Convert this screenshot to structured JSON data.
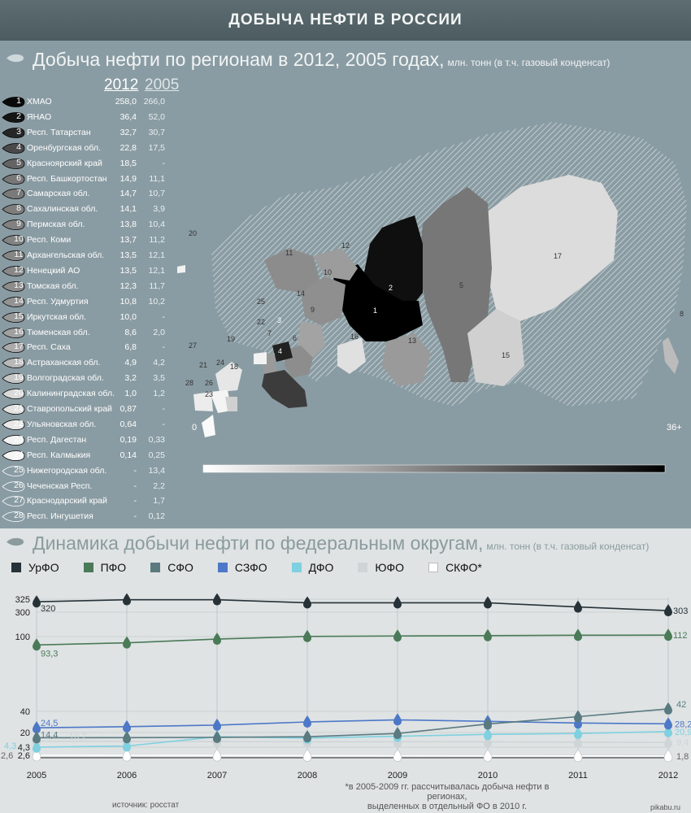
{
  "banner_title": "ДОБЫЧА НЕФТИ В РОССИИ",
  "section1": {
    "title": "Добыча нефти по регионам в 2012, 2005 годах,",
    "unit": "млн. тонн (в т.ч. газовый конденсат)",
    "col_2012": "2012",
    "col_2005": "2005",
    "regions": [
      {
        "rank": "1",
        "name": "ХМАО",
        "v2012": "258,0",
        "v2005": "266,0",
        "color": "#0a0a0a"
      },
      {
        "rank": "2",
        "name": "ЯНАО",
        "v2012": "36,4",
        "v2005": "52,0",
        "color": "#151515"
      },
      {
        "rank": "3",
        "name": "Респ. Татарстан",
        "v2012": "32,7",
        "v2005": "30,7",
        "color": "#262626"
      },
      {
        "rank": "4",
        "name": "Оренбургская обл.",
        "v2012": "22,8",
        "v2005": "17,5",
        "color": "#4a4a4a"
      },
      {
        "rank": "5",
        "name": "Красноярский край",
        "v2012": "18,5",
        "v2005": "-",
        "color": "#646464"
      },
      {
        "rank": "6",
        "name": "Респ. Башкортостан",
        "v2012": "14,9",
        "v2005": "11,1",
        "color": "#777777"
      },
      {
        "rank": "7",
        "name": "Самарская обл.",
        "v2012": "14,7",
        "v2005": "10,7",
        "color": "#7a7a7a"
      },
      {
        "rank": "8",
        "name": "Сахалинская обл.",
        "v2012": "14,1",
        "v2005": "3,9",
        "color": "#7e7e7e"
      },
      {
        "rank": "9",
        "name": "Пермская обл.",
        "v2012": "13,8",
        "v2005": "10,4",
        "color": "#818181"
      },
      {
        "rank": "10",
        "name": "Респ. Коми",
        "v2012": "13,7",
        "v2005": "11,2",
        "color": "#838383"
      },
      {
        "rank": "11",
        "name": "Архангельская обл.",
        "v2012": "13,5",
        "v2005": "12,1",
        "color": "#868686"
      },
      {
        "rank": "12",
        "name": "Ненецкий АО",
        "v2012": "13,5",
        "v2005": "12,1",
        "color": "#888888"
      },
      {
        "rank": "13",
        "name": "Томская обл.",
        "v2012": "12,3",
        "v2005": "11,7",
        "color": "#8c8c8c"
      },
      {
        "rank": "14",
        "name": "Респ. Удмуртия",
        "v2012": "10,8",
        "v2005": "10,2",
        "color": "#939393"
      },
      {
        "rank": "15",
        "name": "Иркутская обл.",
        "v2012": "10,0",
        "v2005": "-",
        "color": "#979797"
      },
      {
        "rank": "16",
        "name": "Тюменская обл.",
        "v2012": "8,6",
        "v2005": "2,0",
        "color": "#a0a0a0"
      },
      {
        "rank": "17",
        "name": "Респ. Саха",
        "v2012": "6,8",
        "v2005": "-",
        "color": "#aaaaaa"
      },
      {
        "rank": "18",
        "name": "Астраханская обл.",
        "v2012": "4,9",
        "v2005": "4,2",
        "color": "#b8b8b8"
      },
      {
        "rank": "19",
        "name": "Волгоградская обл.",
        "v2012": "3,2",
        "v2005": "3,5",
        "color": "#c6c6c6"
      },
      {
        "rank": "20",
        "name": "Калининградская обл.",
        "v2012": "1,0",
        "v2005": "1,2",
        "color": "#dadada"
      },
      {
        "rank": "21",
        "name": "Ставропольский край",
        "v2012": "0,87",
        "v2005": "-",
        "color": "#e2e2e2"
      },
      {
        "rank": "22",
        "name": "Ульяновская обл.",
        "v2012": "0,64",
        "v2005": "-",
        "color": "#e8e8e8"
      },
      {
        "rank": "23",
        "name": "Респ. Дагестан",
        "v2012": "0,19",
        "v2005": "0,33",
        "color": "#f2f2f2"
      },
      {
        "rank": "24",
        "name": "Респ. Калмыкия",
        "v2012": "0,14",
        "v2005": "0,25",
        "color": "#f5f5f5"
      },
      {
        "rank": "25",
        "name": "Нижегородская обл.",
        "v2012": "-",
        "v2005": "13,4",
        "color": "none"
      },
      {
        "rank": "26",
        "name": "Чеченская Респ.",
        "v2012": "-",
        "v2005": "2,2",
        "color": "none"
      },
      {
        "rank": "27",
        "name": "Краснодарский край",
        "v2012": "-",
        "v2005": "1,7",
        "color": "none"
      },
      {
        "rank": "28",
        "name": "Респ. Ингушетия",
        "v2012": "-",
        "v2005": "0,12",
        "color": "none"
      }
    ],
    "scale_min": "0",
    "scale_max": "36+"
  },
  "section2": {
    "title": "Динамика добычи нефти по федеральным округам,",
    "unit": "млн. тонн (в т.ч. газовый конденсат)",
    "note_line1": "*в 2005-2009 гг. рассчитывалась добыча нефти в регионах,",
    "note_line2": "выделенных в отдельный ФО в 2010 г.",
    "source": "источник: росстат",
    "watermark": "pikabu.ru"
  },
  "chart_data": {
    "type": "line",
    "x": [
      "2005",
      "2006",
      "2007",
      "2008",
      "2009",
      "2010",
      "2011",
      "2012"
    ],
    "y_ticks": [
      "2,6",
      "4,3",
      "20",
      "40",
      "100",
      "300",
      "325"
    ],
    "series": [
      {
        "name": "УрФО",
        "color": "#263238",
        "values": [
          320,
          324,
          324,
          318,
          318,
          318,
          310,
          303
        ],
        "label_start": "320",
        "label_end": "303"
      },
      {
        "name": "ПФО",
        "color": "#4a7a57",
        "values": [
          93.3,
          95,
          98,
          101,
          105,
          108,
          111,
          112
        ],
        "label_start": "93,3",
        "label_end": "112"
      },
      {
        "name": "СФО",
        "color": "#5a7a80",
        "values": [
          14.4,
          14.5,
          14.8,
          15.5,
          19,
          28,
          35,
          42
        ],
        "label_start": "14,4",
        "label_end": "42"
      },
      {
        "name": "СЗФО",
        "color": "#4d78c7",
        "values": [
          24.5,
          25.5,
          27,
          30,
          32,
          30.5,
          29,
          28.2
        ],
        "label_start": "24,5",
        "label_end": "28,2"
      },
      {
        "name": "ДФО",
        "color": "#7fd0e0",
        "values": [
          4.3,
          5.5,
          15.5,
          14,
          16,
          18,
          19,
          20.9
        ],
        "label_start": "4,3",
        "label_end": "20,9"
      },
      {
        "name": "ЮФО",
        "color": "#cfd4d6",
        "values": [
          10.7,
          10.5,
          10.2,
          10,
          10,
          10,
          9.6,
          9.4
        ],
        "label_start": "10,7",
        "label_end": "9,4"
      },
      {
        "name": "СКФО*",
        "color": "#ffffff",
        "values": [
          2.6,
          2.5,
          2.4,
          2.2,
          2.1,
          2,
          1.9,
          1.8
        ],
        "label_start": "2,6",
        "label_end": "1,8"
      }
    ]
  },
  "map_labels": [
    "1",
    "2",
    "3",
    "4",
    "5",
    "6",
    "7",
    "8",
    "9",
    "10",
    "11",
    "12",
    "13",
    "14",
    "15",
    "16",
    "17",
    "18",
    "19",
    "20",
    "21",
    "22",
    "23",
    "24",
    "25",
    "26",
    "27",
    "28"
  ]
}
